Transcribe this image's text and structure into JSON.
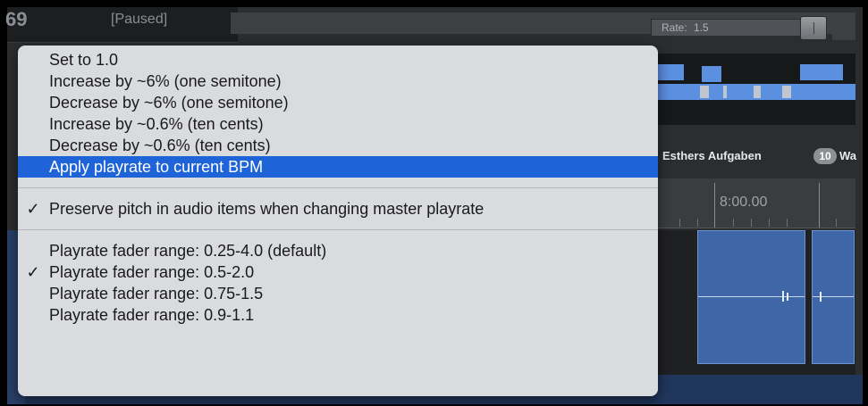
{
  "transport": {
    "position": "69",
    "state": "[Paused]"
  },
  "playrate": {
    "label": "Rate:",
    "value": "1.5"
  },
  "regions": {
    "esthers_label": "Esthers Aufgaben",
    "num_badge": "10",
    "wa_label": "Wa"
  },
  "timeline": {
    "time": "8:00.00"
  },
  "menu": {
    "items": [
      {
        "label": "Set to 1.0",
        "checked": false
      },
      {
        "label": "Increase by ~6% (one semitone)",
        "checked": false
      },
      {
        "label": "Decrease by ~6% (one semitone)",
        "checked": false
      },
      {
        "label": "Increase by ~0.6% (ten cents)",
        "checked": false
      },
      {
        "label": "Decrease by ~0.6% (ten cents)",
        "checked": false
      },
      {
        "label": "Apply playrate to current BPM",
        "checked": false,
        "selected": true
      }
    ],
    "preserve_pitch": {
      "label": "Preserve pitch in audio items when changing master playrate",
      "checked": true
    },
    "ranges": [
      {
        "label": "Playrate fader range: 0.25-4.0 (default)",
        "checked": false
      },
      {
        "label": "Playrate fader range: 0.5-2.0",
        "checked": true
      },
      {
        "label": "Playrate fader range: 0.75-1.5",
        "checked": false
      },
      {
        "label": "Playrate fader range: 0.9-1.1",
        "checked": false
      }
    ],
    "check_glyph": "✓"
  },
  "colors": {
    "highlight": "#1f63d9",
    "menu_bg": "#d9dbde",
    "region_blue": "#5b8fe0"
  }
}
